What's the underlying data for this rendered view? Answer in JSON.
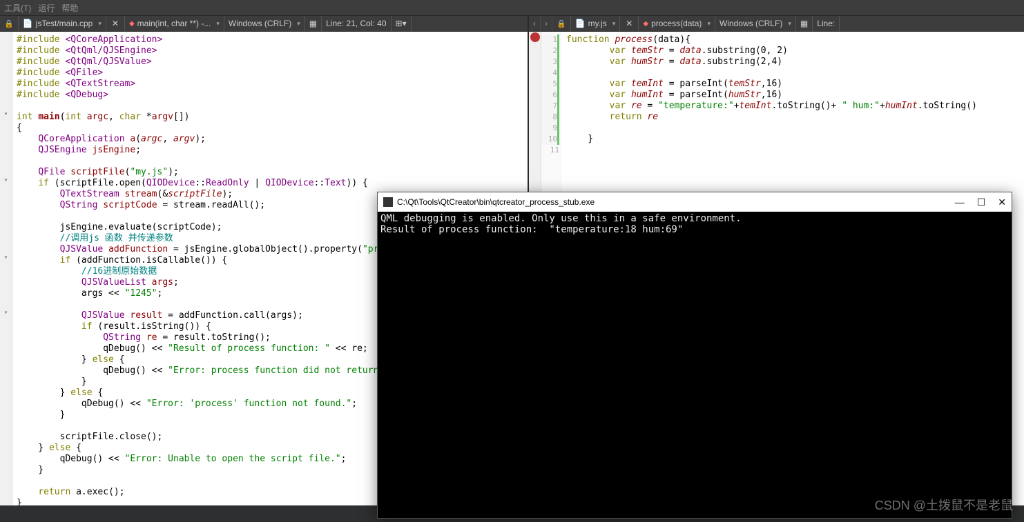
{
  "menubar": {
    "items": [
      "工具(T)",
      "运行",
      "帮助"
    ]
  },
  "left": {
    "file": "jsTest/main.cpp",
    "symbol": "main(int, char **) -...",
    "encoding": "Windows (CRLF)",
    "lineinfo": "Line: 21, Col: 40",
    "code_html": "<span class='kw'>#include</span> <span class='ty'>&lt;QCoreApplication&gt;</span>\n<span class='kw'>#include</span> <span class='ty'>&lt;QtQml/QJSEngine&gt;</span>\n<span class='kw'>#include</span> <span class='ty'>&lt;QtQml/QJSValue&gt;</span>\n<span class='kw'>#include</span> <span class='ty'>&lt;QFile&gt;</span>\n<span class='kw'>#include</span> <span class='ty'>&lt;QTextStream&gt;</span>\n<span class='kw'>#include</span> <span class='ty'>&lt;QDebug&gt;</span>\n\n<span class='kw'>int</span> <span class='fn'>main</span>(<span class='kw'>int</span> <span class='ar'>argc</span>, <span class='kw'>char</span> *<span class='ar'>argv</span>[])\n{\n    <span class='ty'>QCoreApplication</span> <span class='ar'>a</span>(<span class='it'>argc</span>, <span class='it'>argv</span>);\n    <span class='ty'>QJSEngine</span> <span class='ar'>jsEngine</span>;\n\n    <span class='ty'>QFile</span> <span class='ar'>scriptFile</span>(<span class='st'>\"my.js\"</span>);\n    <span class='kw'>if</span> (scriptFile.open(<span class='ty'>QIODevice</span>::<span class='ty'>ReadOnly</span> | <span class='ty'>QIODevice</span>::<span class='ty'>Text</span>)) {\n        <span class='ty'>QTextStream</span> <span class='ar'>stream</span>(&amp;<span class='it'>scriptFile</span>);\n        <span class='ty'>QString</span> <span class='ar'>scriptCode</span> = stream.readAll();\n\n        jsEngine.evaluate(scriptCode);\n        <span class='cm'>//调用js 函数 并传递参数</span>\n        <span class='ty'>QJSValue</span> <span class='ar'>addFunction</span> = jsEngine.globalObject().property(<span class='st'>\"process\"</span>);\n        <span class='kw'>if</span> (addFunction.isCallable()) {\n            <span class='cm'>//16进制原始数据</span>\n            <span class='ty'>QJSValueList</span> <span class='ar'>args</span>;\n            args &lt;&lt; <span class='st'>\"1245\"</span>;\n\n            <span class='ty'>QJSValue</span> <span class='ar'>result</span> = addFunction.call(args);\n            <span class='kw'>if</span> (result.isString()) {\n                <span class='ty'>QString</span> <span class='ar'>re</span> = result.toString();\n                qDebug() &lt;&lt; <span class='st'>\"Result of process function: \"</span> &lt;&lt; re;\n            } <span class='kw'>else</span> {\n                qDebug() &lt;&lt; <span class='st'>\"Error: process function did not return a valid</span>\n            }\n        } <span class='kw'>else</span> {\n            qDebug() &lt;&lt; <span class='st'>\"Error: 'process' function not found.\"</span>;\n        }\n\n        scriptFile.close();\n    } <span class='kw'>else</span> {\n        qDebug() &lt;&lt; <span class='st'>\"Error: Unable to open the script file.\"</span>;\n    }\n\n    <span class='kw'>return</span> a.exec();\n}"
  },
  "right": {
    "file": "my.js",
    "symbol": "process(data)",
    "encoding": "Windows (CRLF)",
    "lineinfo": "Line:",
    "line_count": 11,
    "code_html": "<span class='kw'>function</span> <span class='it'>process</span>(data){\n        <span class='kw'>var</span> <span class='it'>temStr</span> = <span class='it'>data</span>.substring(0, 2)\n        <span class='kw'>var</span> <span class='it'>humStr</span> = <span class='it'>data</span>.substring(2,4)\n\n        <span class='kw'>var</span> <span class='it'>temInt</span> = parseInt(<span class='it'>temStr</span>,16)\n        <span class='kw'>var</span> <span class='it'>humInt</span> = parseInt(<span class='it'>humStr</span>,16)\n        <span class='kw'>var</span> <span class='it'>re</span> = <span class='st'>\"temperature:\"</span>+<span class='it'>temInt</span>.toString()+ <span class='st'>\" hum:\"</span>+<span class='it'>humInt</span>.toString()\n        <span class='kw'>return</span> <span class='it'>re</span>\n\n    }\n"
  },
  "console": {
    "title": "C:\\Qt\\Tools\\QtCreator\\bin\\qtcreator_process_stub.exe",
    "lines": [
      "QML debugging is enabled. Only use this in a safe environment.",
      "Result of process function:  \"temperature:18 hum:69\""
    ]
  },
  "watermark": "CSDN @土拨鼠不是老鼠"
}
